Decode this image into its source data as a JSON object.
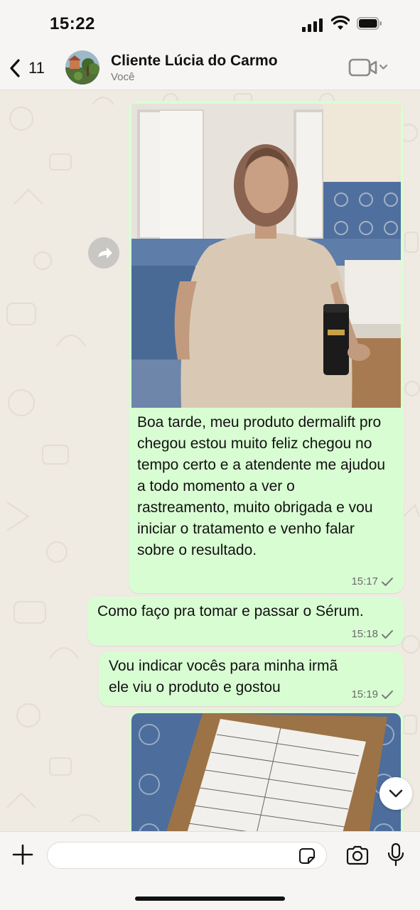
{
  "status_bar": {
    "time": "15:22"
  },
  "header": {
    "back_count": "11",
    "contact_name": "Cliente Lúcia do Carmo",
    "subtitle": "Você"
  },
  "messages": [
    {
      "type": "image",
      "image_desc": "photo-woman-holding-serum-bottle"
    },
    {
      "type": "text",
      "text": "Boa tarde, meu produto dermalift pro chegou estou muito feliz chegou no tempo certo e a atendente me ajudou a todo momento a ver o rastreamento, muito obrigada e vou iniciar o tratamento e venho falar sobre o resultado.",
      "time": "15:17"
    },
    {
      "type": "text",
      "text": "Como faço pra tomar e passar o Sérum.",
      "time": "15:18"
    },
    {
      "type": "text",
      "text": "Vou indicar vocês para minha irmã ele viu o produto e gostou",
      "time": "15:19"
    },
    {
      "type": "image",
      "image_desc": "photo-shipping-label-document"
    }
  ],
  "composer": {
    "placeholder": ""
  },
  "colors": {
    "outgoing_bubble": "#d9fdd3",
    "chat_bg": "#efeae2",
    "bar_bg": "#f6f5f3",
    "accent_check": "#7a7a7a"
  }
}
